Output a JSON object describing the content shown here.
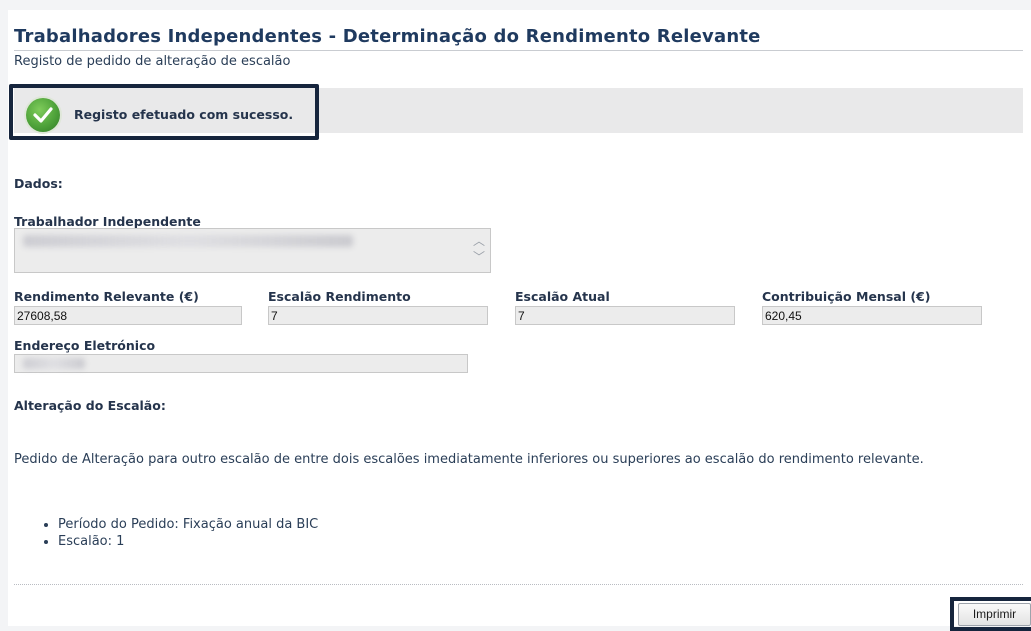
{
  "header": {
    "title": "Trabalhadores Independentes - Determinação do Rendimento Relevante",
    "subtitle": "Registo de pedido de alteração de escalão"
  },
  "alert": {
    "icon": "check-circle-icon",
    "message": "Registo efetuado com sucesso.",
    "color": "#4ea23a"
  },
  "dados": {
    "heading": "Dados:",
    "trabalhador_label": "Trabalhador Independente",
    "trabalhador_value": "",
    "rendimento_label": "Rendimento Relevante (€)",
    "rendimento_value": "27608,58",
    "escalao_rendimento_label": "Escalão Rendimento",
    "escalao_rendimento_value": "7",
    "escalao_atual_label": "Escalão Atual",
    "escalao_atual_value": "7",
    "contribuicao_label": "Contribuição Mensal (€)",
    "contribuicao_value": "620,45",
    "email_label": "Endereço Eletrónico",
    "email_value": ""
  },
  "alteracao": {
    "heading": "Alteração do Escalão:",
    "description": "Pedido de Alteração para outro escalão de entre dois escalões imediatamente inferiores ou superiores ao escalão do rendimento relevante.",
    "items": [
      "Período do Pedido: Fixação anual da BIC",
      "Escalão: 1"
    ]
  },
  "footer": {
    "print_label": "Imprimir"
  }
}
